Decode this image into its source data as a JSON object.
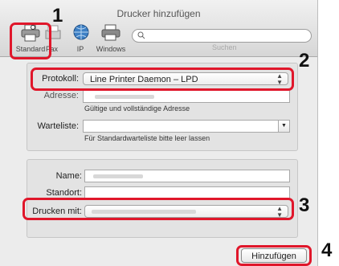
{
  "window": {
    "title": "Drucker hinzufügen"
  },
  "toolbar": {
    "items": [
      {
        "label": "Standard",
        "icon": "printer-search-icon"
      },
      {
        "label": "Fax",
        "icon": "fax-icon"
      },
      {
        "label": "IP",
        "icon": "globe-icon"
      },
      {
        "label": "Windows",
        "icon": "windows-printer-icon"
      }
    ],
    "search_label": "Suchen",
    "search_value": ""
  },
  "form": {
    "protocol_label": "Protokoll:",
    "protocol_value": "Line Printer Daemon – LPD",
    "address_label": "Adresse:",
    "address_hint": "Gültige und vollständige Adresse",
    "queue_label": "Warteliste:",
    "queue_value": "",
    "queue_hint": "Für Standardwarteliste bitte leer lassen",
    "name_label": "Name:",
    "location_label": "Standort:",
    "use_label": "Drucken mit:"
  },
  "buttons": {
    "add": "Hinzufügen"
  },
  "callouts": [
    "1",
    "2",
    "3",
    "4"
  ],
  "colors": {
    "callout": "#e0172b"
  }
}
